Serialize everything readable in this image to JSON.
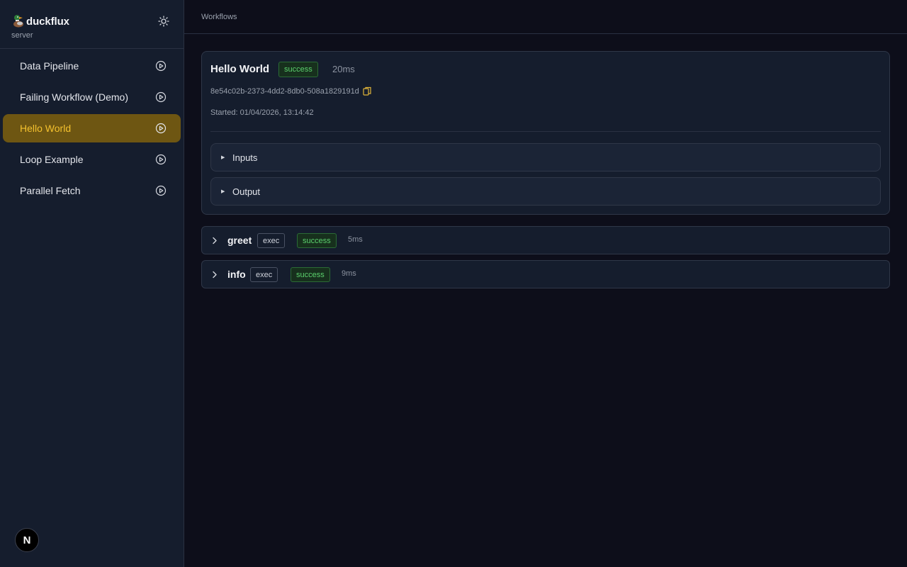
{
  "brand": {
    "name": "duckflux",
    "subtitle": "server",
    "logo_icon": "duck-icon",
    "theme_icon": "sun-icon"
  },
  "sidebar": {
    "items": [
      {
        "label": "Data Pipeline",
        "active": false
      },
      {
        "label": "Failing Workflow (Demo)",
        "active": false
      },
      {
        "label": "Hello World",
        "active": true
      },
      {
        "label": "Loop Example",
        "active": false
      },
      {
        "label": "Parallel Fetch",
        "active": false
      }
    ],
    "item_icon": "play-circle-icon",
    "avatar_letter": "N"
  },
  "breadcrumb": "Workflows",
  "run": {
    "title": "Hello World",
    "status": "success",
    "duration": "20ms",
    "id": "8e54c02b-2373-4dd2-8db0-508a1829191d",
    "copy_icon": "clipboard-icon",
    "started": "Started: 01/04/2026, 13:14:42",
    "sections": [
      "Inputs",
      "Output"
    ]
  },
  "steps": [
    {
      "name": "greet",
      "type": "exec",
      "status": "success",
      "duration": "5ms"
    },
    {
      "name": "info",
      "type": "exec",
      "status": "success",
      "duration": "9ms"
    }
  ],
  "colors": {
    "accent": "#f4c12e",
    "active_bg": "#6e5612",
    "success": "#5bd16d",
    "panel": "#151d2d",
    "background": "#0d0e1a"
  }
}
